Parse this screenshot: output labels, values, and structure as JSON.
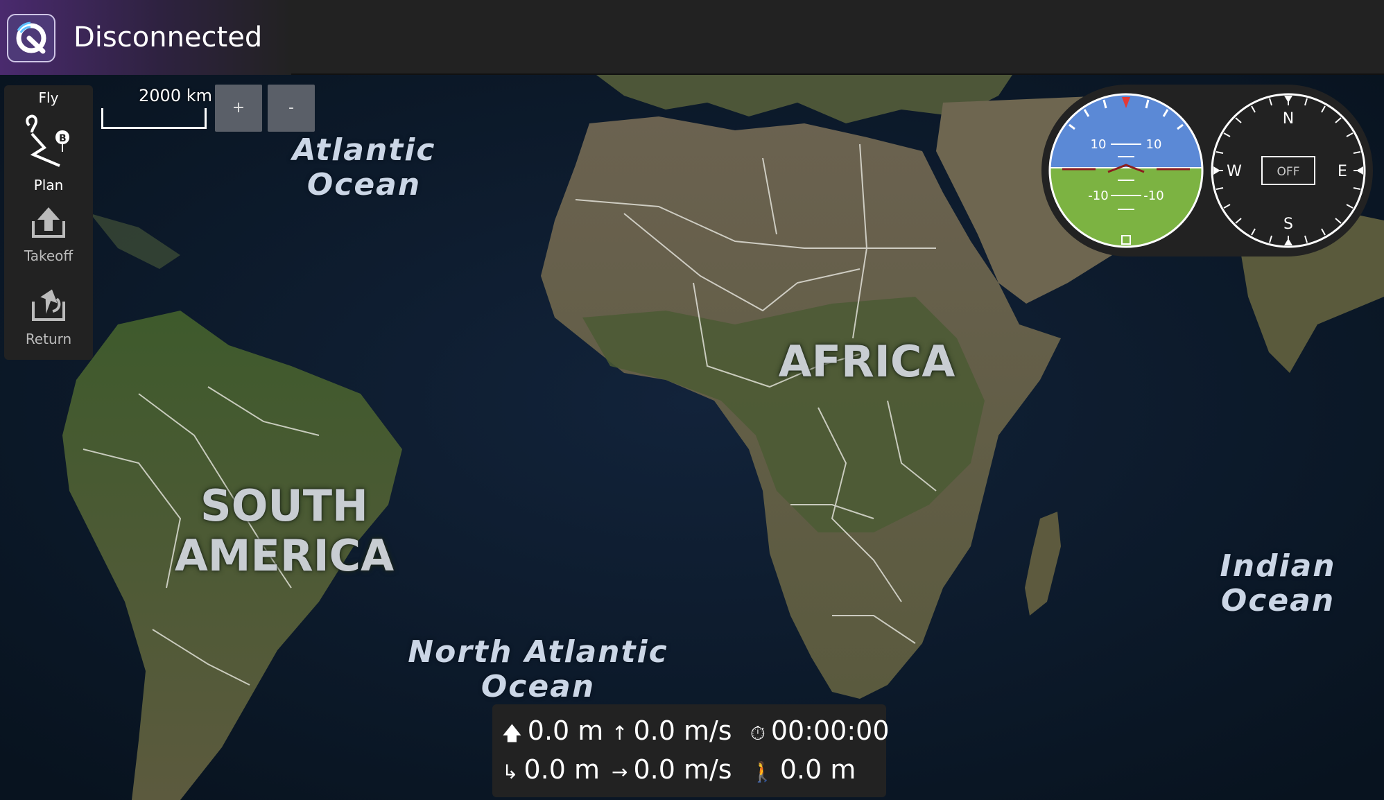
{
  "toolbar": {
    "status": "Disconnected",
    "app_icon": "qgc-logo-icon",
    "accent_color": "#4a2a6e"
  },
  "sidebar": {
    "fly_label": "Fly",
    "items": [
      {
        "label": "Plan",
        "icon": "plan-route-icon"
      },
      {
        "label": "Takeoff",
        "icon": "takeoff-icon"
      },
      {
        "label": "Return",
        "icon": "return-icon"
      }
    ]
  },
  "map": {
    "scale_label": "2000 km",
    "zoom_in_label": "+",
    "zoom_out_label": "-",
    "labels": {
      "atlantic_1": "Atlantic",
      "atlantic_2": "Ocean",
      "africa": "AFRICA",
      "south_america_1": "SOUTH",
      "south_america_2": "AMERICA",
      "north_atlantic": "North Atlantic Ocean",
      "indian_1": "Indian",
      "indian_2": "Ocean"
    }
  },
  "instruments": {
    "attitude": {
      "pitch_labels": [
        "10",
        "10",
        "-10",
        "-10"
      ],
      "sky_color": "#5b89d6",
      "ground_color": "#7cb342"
    },
    "compass": {
      "n": "N",
      "e": "E",
      "s": "S",
      "w": "W",
      "status": "OFF"
    }
  },
  "telemetry": {
    "altitude": "0.0 m",
    "vertical_speed": "0.0 m/s",
    "flight_time": "00:00:00",
    "distance_to_home": "0.0 m",
    "horizontal_speed": "0.0 m/s",
    "distance_flown": "0.0 m",
    "icons": {
      "altitude": "arrow-up-bold-icon",
      "vertical_speed": "arrow-up-icon",
      "flight_time": "stopwatch-icon",
      "distance_to_home": "turn-right-icon",
      "horizontal_speed": "arrow-right-icon",
      "distance_flown": "walking-icon"
    }
  }
}
